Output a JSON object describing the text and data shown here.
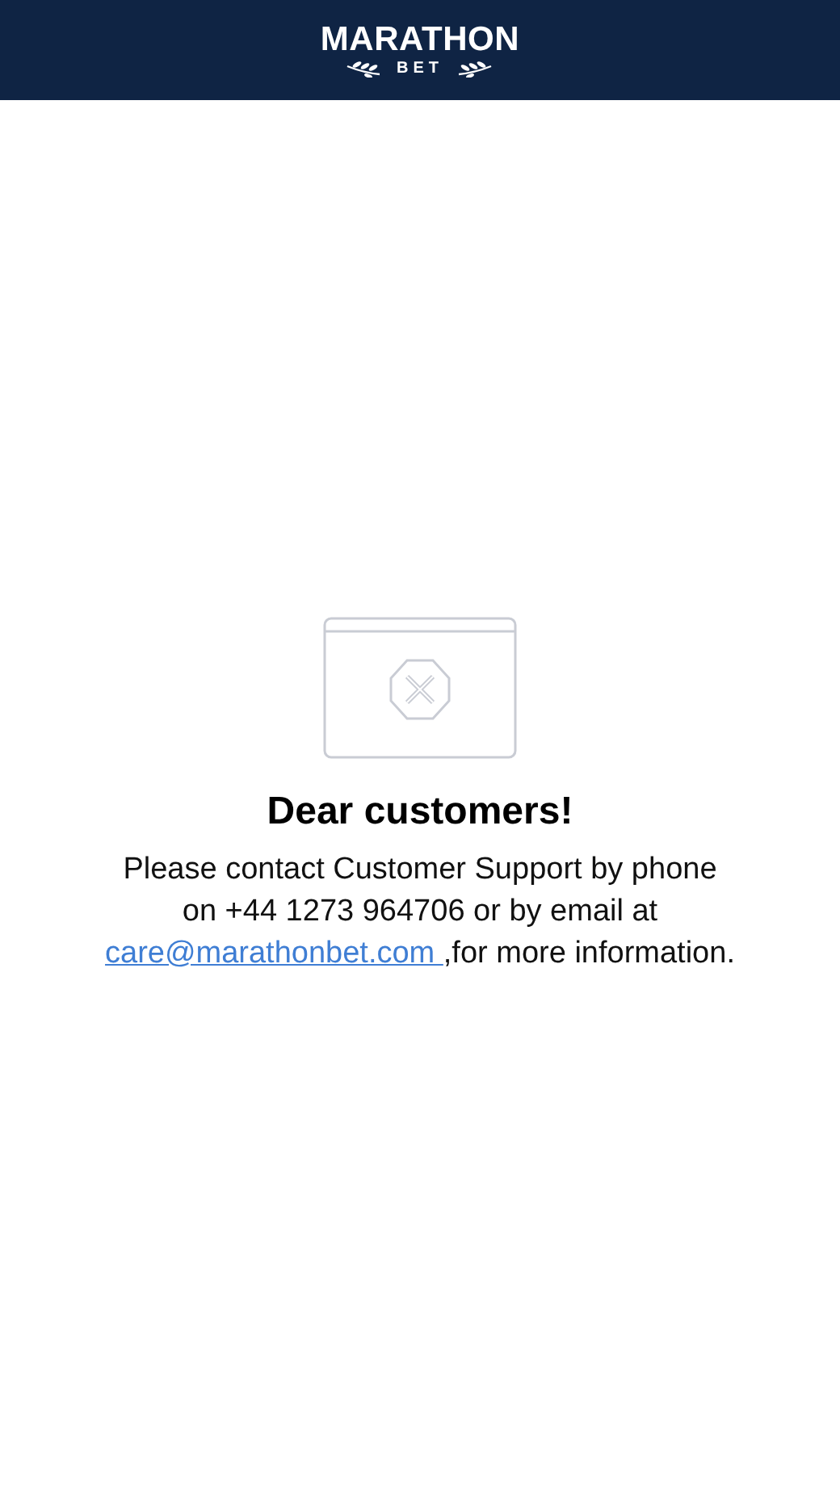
{
  "header": {
    "logo": {
      "title": "MARATHON",
      "subtitle": "BET"
    }
  },
  "notice": {
    "title": "Dear customers!",
    "text_before": "Please contact Customer Support by phone on +44 1273 964706 or by email at",
    "link": "care@marathonbet.com ",
    "text_after": ",for more information."
  }
}
